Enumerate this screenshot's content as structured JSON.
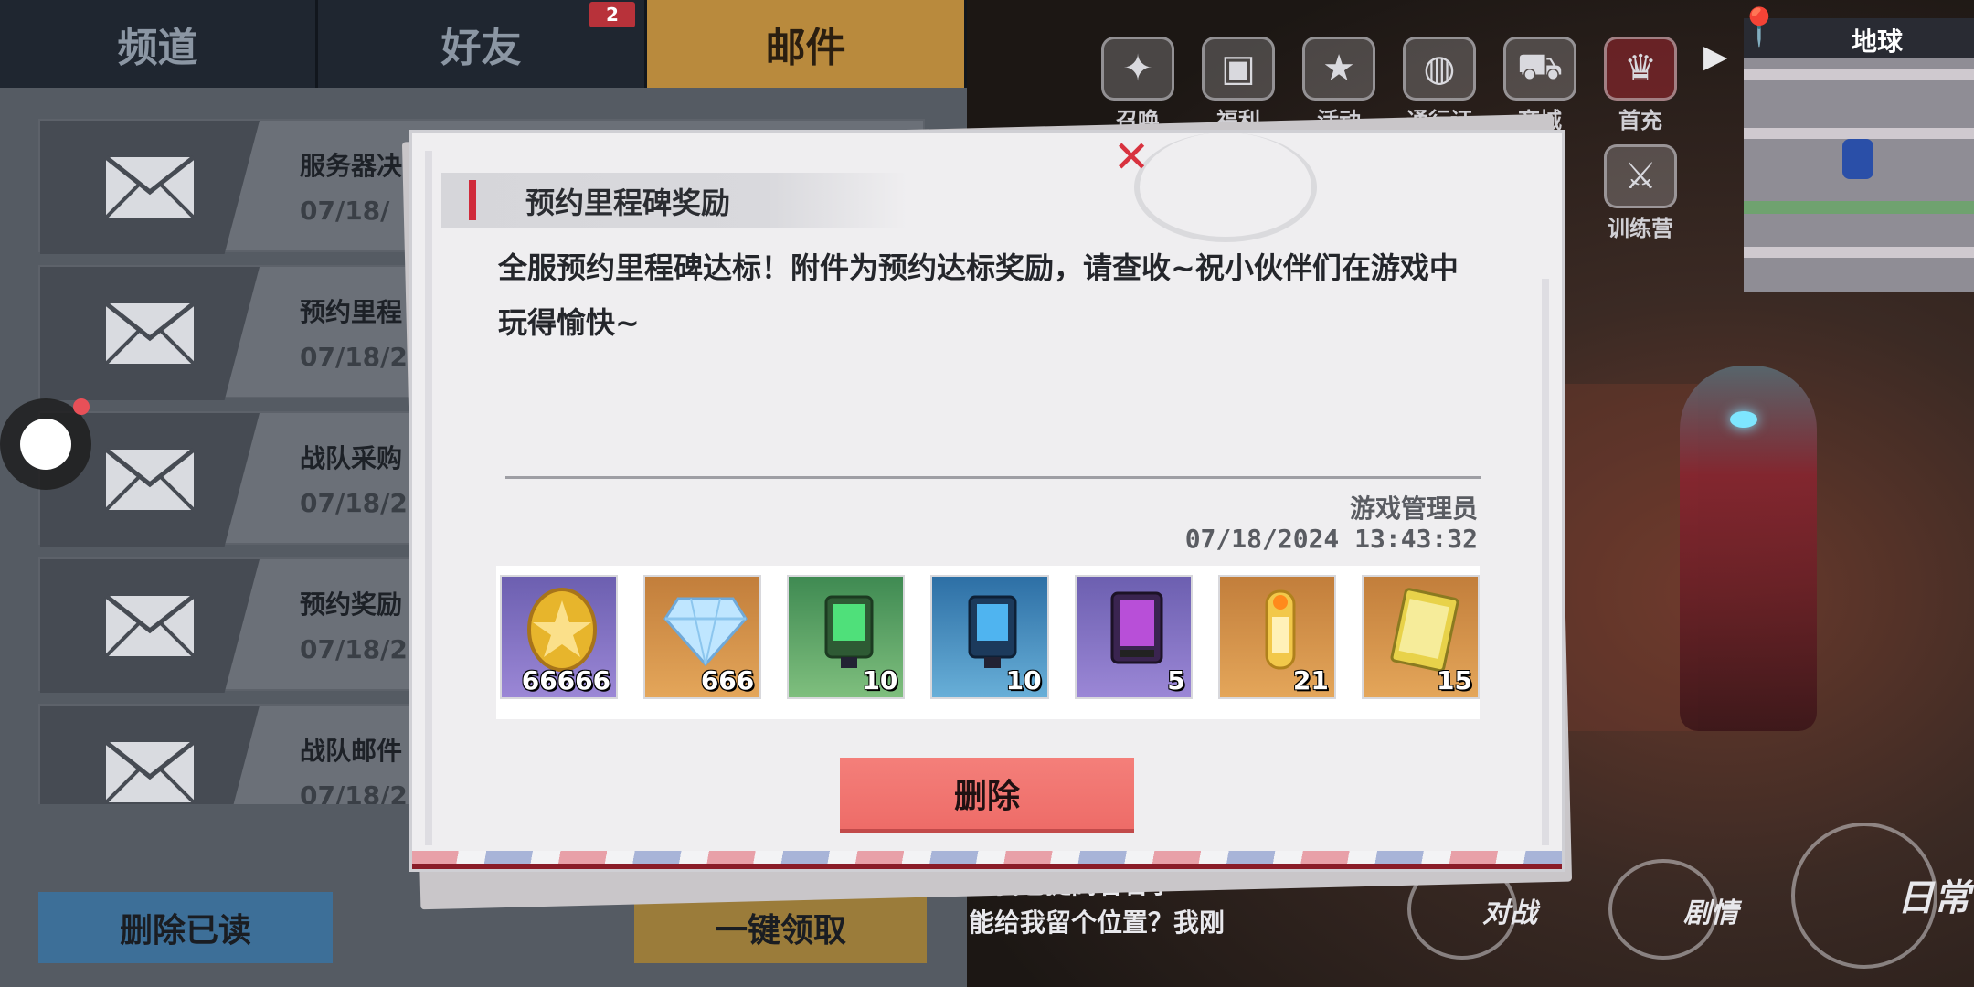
{
  "tabs": {
    "channel": "频道",
    "friends": "好友",
    "friends_badge": "2",
    "mail": "邮件"
  },
  "mail_list": [
    {
      "title": "服务器决",
      "date": "07/18/"
    },
    {
      "title": "预约里程",
      "date": "07/18/2"
    },
    {
      "title": "战队采购",
      "date": "07/18/2"
    },
    {
      "title": "预约奖励",
      "date": "07/18/20"
    },
    {
      "title": "战队邮件",
      "date": "07/18/20"
    }
  ],
  "left_buttons": {
    "delete_read": "删除已读",
    "claim_all": "一键领取"
  },
  "top_menu": [
    {
      "label": "召唤",
      "icon": "summon-icon"
    },
    {
      "label": "福利",
      "icon": "welfare-chest-icon"
    },
    {
      "label": "活动",
      "icon": "event-star-icon"
    },
    {
      "label": "通行证",
      "icon": "pass-planet-icon"
    },
    {
      "label": "商城",
      "icon": "shop-cart-icon"
    },
    {
      "label": "首充",
      "icon": "first-recharge-icon"
    },
    {
      "label": "训练营",
      "icon": "training-camp-icon"
    }
  ],
  "minimap": {
    "label": "地球"
  },
  "bottom_modes": {
    "versus": "对战",
    "story": "剧情",
    "daily": "日常"
  },
  "chat": {
    "line1": "觉我也提高着名字",
    "line2": "能给我留个位置？我刚"
  },
  "modal": {
    "title": "预约里程碑奖励",
    "close": "✕",
    "body": "全服预约里程碑达标！附件为预约达标奖励，请查收~祝小伙伴们在游戏中玩得愉快~",
    "sender": "游戏管理员",
    "timestamp": "07/18/2024  13:43:32",
    "delete_label": "删除",
    "rewards": [
      {
        "icon": "gold-coin-icon",
        "qty": "66666",
        "color": "purple"
      },
      {
        "icon": "diamond-icon",
        "qty": "666",
        "color": "orange"
      },
      {
        "icon": "green-card-device-icon",
        "qty": "10",
        "color": "green"
      },
      {
        "icon": "blue-card-device-icon",
        "qty": "10",
        "color": "blue"
      },
      {
        "icon": "ultraman-purple-card-icon",
        "qty": "5",
        "color": "purple"
      },
      {
        "icon": "golden-capsule-icon",
        "qty": "21",
        "color": "orange"
      },
      {
        "icon": "gold-card-icon",
        "qty": "15",
        "color": "orange"
      }
    ]
  },
  "colors": {
    "accent_red": "#d02a3a",
    "delete_button": "#f47f7a",
    "mail_tab": "#b98a3d"
  }
}
